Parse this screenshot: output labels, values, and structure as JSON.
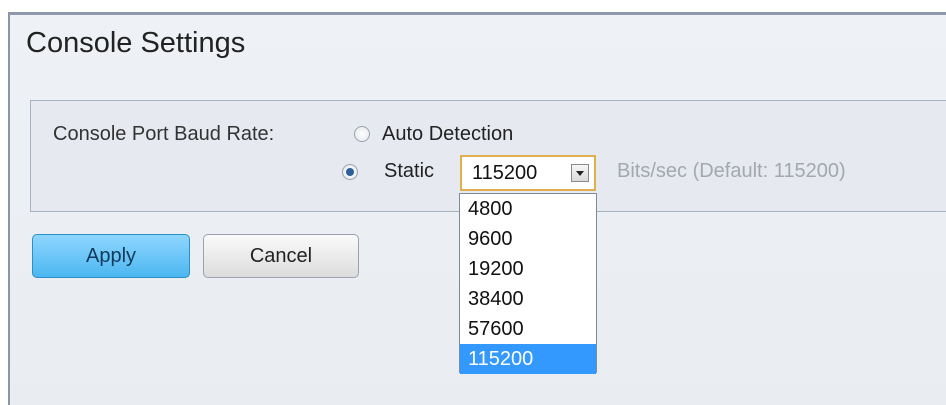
{
  "page": {
    "title": "Console Settings"
  },
  "settings": {
    "baud_label": "Console Port Baud Rate:",
    "radio_auto": {
      "label": "Auto Detection",
      "checked": false
    },
    "radio_static": {
      "label": "Static",
      "checked": true
    },
    "baud_select": {
      "value": "115200",
      "options": [
        "4800",
        "9600",
        "19200",
        "38400",
        "57600",
        "115200"
      ],
      "selected_option": "115200"
    },
    "hint": "Bits/sec (Default: 115200)"
  },
  "buttons": {
    "apply": "Apply",
    "cancel": "Cancel"
  },
  "colors": {
    "accent": "#3399ff",
    "apply_button": "#4cb7f0"
  },
  "icons": {
    "select_arrow": "chevron-down-icon"
  }
}
